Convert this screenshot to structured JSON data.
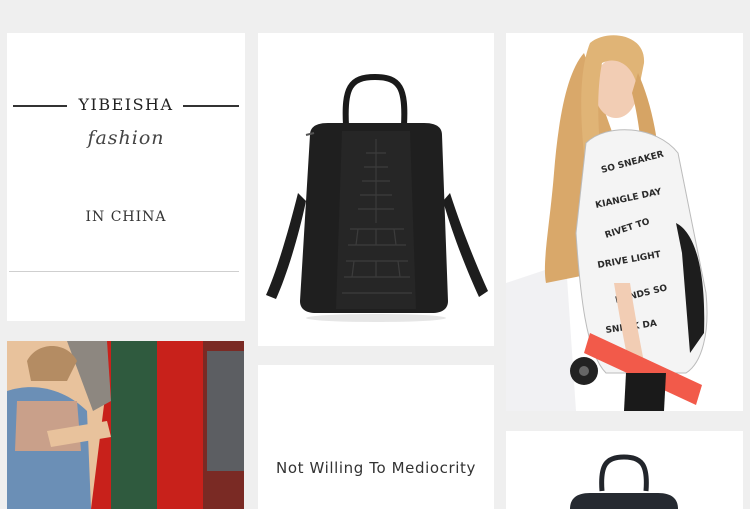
{
  "brand_card": {
    "brand_name": "YIBEISHA",
    "tagline": "fashion",
    "origin": "IN CHINA"
  },
  "slogan_card": {
    "slogan": "Not Willing To Mediocrity"
  },
  "colors": {
    "page_background": "#efefef",
    "card_background": "#ffffff",
    "bag_leather": "#1a1a1a",
    "skateboard": "#f25a4a"
  },
  "images": {
    "bag_photo": "black-crocodile-leather-backpack",
    "model_photo": "model-with-backpack-and-skateboard",
    "street_photo": "model-by-red-wall",
    "bag_photo_2": "backpack-partial"
  }
}
